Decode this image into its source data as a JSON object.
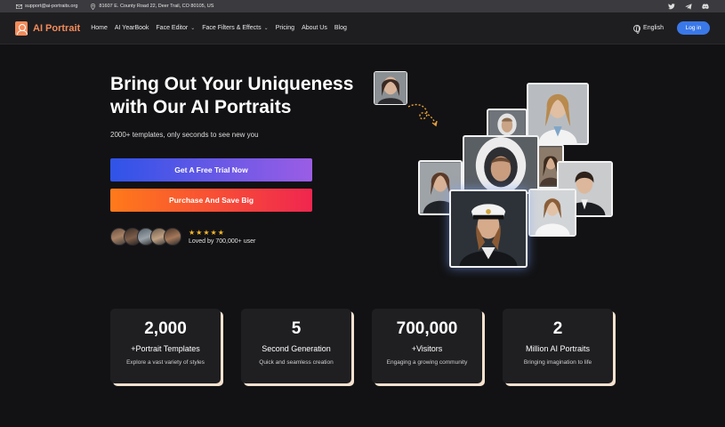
{
  "topbar": {
    "email": "support@ai-portraits.org",
    "address": "81607 E. County Road 22, Deer Trail, CO 80105, US",
    "social_icons": [
      "twitter-icon",
      "telegram-icon",
      "discord-icon"
    ]
  },
  "nav": {
    "logo_text": "AI Portrait",
    "items": [
      {
        "label": "Home",
        "dropdown": false
      },
      {
        "label": "AI YearBook",
        "dropdown": false
      },
      {
        "label": "Face Editor",
        "dropdown": true
      },
      {
        "label": "Face Filters & Effects",
        "dropdown": true
      },
      {
        "label": "Pricing",
        "dropdown": false
      },
      {
        "label": "About Us",
        "dropdown": false
      },
      {
        "label": "Blog",
        "dropdown": false
      }
    ],
    "language": "English",
    "login_label": "Log in"
  },
  "hero": {
    "title_line1": "Bring Out Your Uniqueness",
    "title_line2": "with Our AI Portraits",
    "subtitle": "2000+ templates, only seconds to see new you",
    "trial_button": "Get A Free Trial Now",
    "buy_button": "Purchase And Save Big",
    "rating_stars": 5,
    "loved_text": "Loved by 700,000+ user"
  },
  "stats": [
    {
      "number": "2,000",
      "label": "+Portrait Templates",
      "desc": "Explore a vast variety of styles"
    },
    {
      "number": "5",
      "label": "Second Generation",
      "desc": "Quick and seamless creation"
    },
    {
      "number": "700,000",
      "label": "+Visitors",
      "desc": "Engaging a growing community"
    },
    {
      "number": "2",
      "label": "Million AI Portraits",
      "desc": "Bringing imagination to life"
    }
  ],
  "colors": {
    "background": "#121214",
    "brand_orange": "#f38b5a",
    "login_blue": "#3a78e8",
    "star_gold": "#f5b829",
    "stat_shadow": "#f6e2cf"
  }
}
